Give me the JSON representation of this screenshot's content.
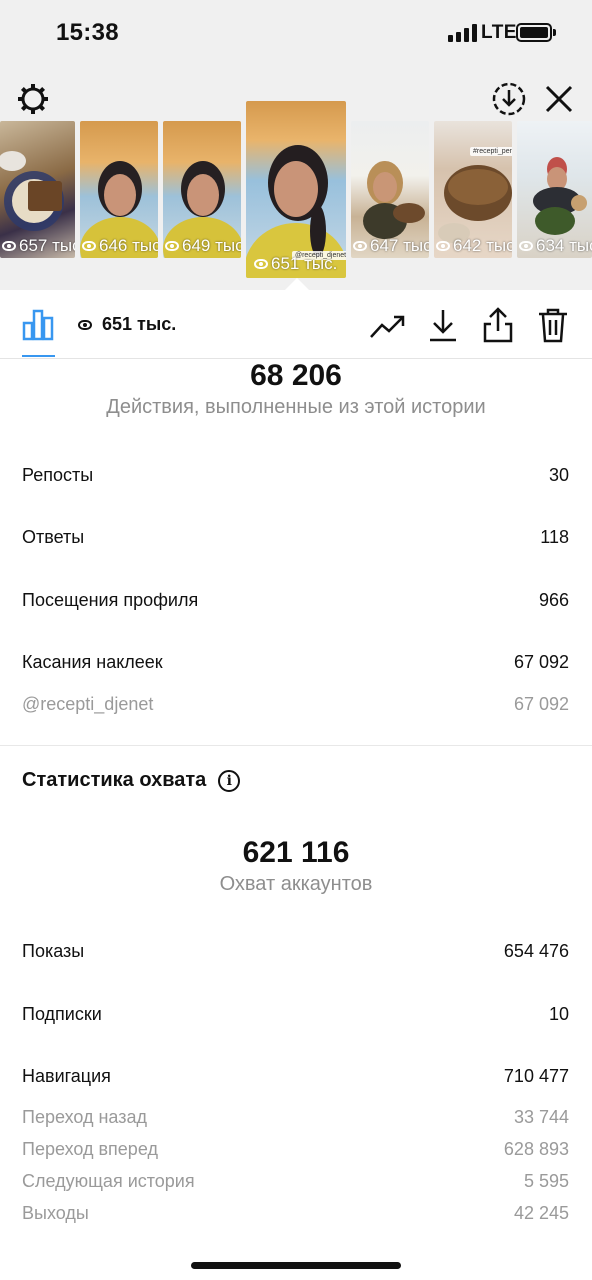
{
  "status_bar": {
    "time": "15:38",
    "network": "LTE"
  },
  "stories": [
    {
      "views": "657 тыс",
      "sticker": ""
    },
    {
      "views": "646 тыс",
      "sticker": ""
    },
    {
      "views": "649 тыс",
      "sticker": ""
    },
    {
      "views": "651 тыс.",
      "sticker": "@recepti_djenet"
    },
    {
      "views": "647 тыс",
      "sticker": ""
    },
    {
      "views": "642 тыс",
      "sticker": "#recepti_pena"
    },
    {
      "views": "634 тыс",
      "sticker": ""
    }
  ],
  "toolbar": {
    "views": "651 тыс."
  },
  "interactions": {
    "total": "68 206",
    "caption": "Действия, выполненные из этой истории",
    "rows": [
      {
        "label": "Репосты",
        "value": "30"
      },
      {
        "label": "Ответы",
        "value": "118"
      },
      {
        "label": "Посещения профиля",
        "value": "966"
      },
      {
        "label": "Касания наклеек",
        "value": "67 092"
      }
    ],
    "sub_rows": [
      {
        "label": "@recepti_djenet",
        "value": "67 092"
      }
    ]
  },
  "reach": {
    "title": "Статистика охвата",
    "total": "621 116",
    "caption": "Охват аккаунтов",
    "rows": [
      {
        "label": "Показы",
        "value": "654 476"
      },
      {
        "label": "Подписки",
        "value": "10"
      },
      {
        "label": "Навигация",
        "value": "710 477"
      }
    ],
    "sub_rows": [
      {
        "label": "Переход назад",
        "value": "33 744"
      },
      {
        "label": "Переход вперед",
        "value": "628 893"
      },
      {
        "label": "Следующая история",
        "value": "5 595"
      },
      {
        "label": "Выходы",
        "value": "42 245"
      }
    ]
  },
  "colors": {
    "accent": "#3897f0",
    "muted": "#8e8e8e"
  }
}
